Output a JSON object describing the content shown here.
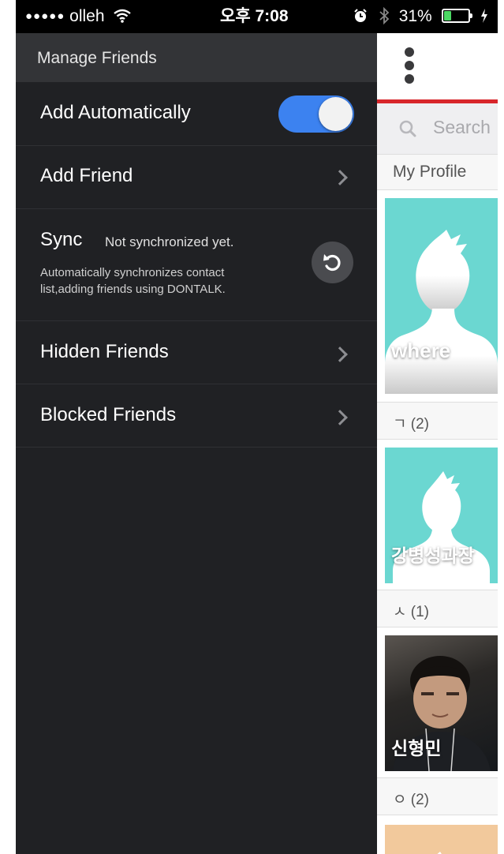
{
  "status_bar": {
    "signal_dots": "●●●●●",
    "carrier": "olleh",
    "time": "오후 7:08",
    "battery_percent": "31%",
    "battery_level": 0.31,
    "icons": [
      "wifi-icon",
      "alarm-icon",
      "bluetooth-icon",
      "battery-icon",
      "charging-icon"
    ]
  },
  "drawer": {
    "title": "Manage Friends",
    "add_automatically": {
      "label": "Add Automatically",
      "enabled": true
    },
    "add_friend": {
      "label": "Add Friend"
    },
    "sync": {
      "label": "Sync",
      "status": "Not synchronized yet.",
      "description": "Automatically synchronizes contact list,adding friends using DONTALK."
    },
    "hidden_friends": {
      "label": "Hidden Friends"
    },
    "blocked_friends": {
      "label": "Blocked Friends"
    }
  },
  "main": {
    "search_placeholder": "Search",
    "sections": {
      "my_profile": "My Profile",
      "giyeok": "ㄱ (2)",
      "siot": "ㅅ (1)",
      "ieung": "ㅇ (2)"
    },
    "cards": {
      "profile_name": "where",
      "friend1_name": "강병성과장",
      "friend2_name": "신형민"
    }
  },
  "colors": {
    "accent_blue": "#3c82f0",
    "drawer_bg": "#202124",
    "header_bg": "#333437",
    "red_line": "#d8262b",
    "avatar_teal": "#6bd7d1"
  }
}
